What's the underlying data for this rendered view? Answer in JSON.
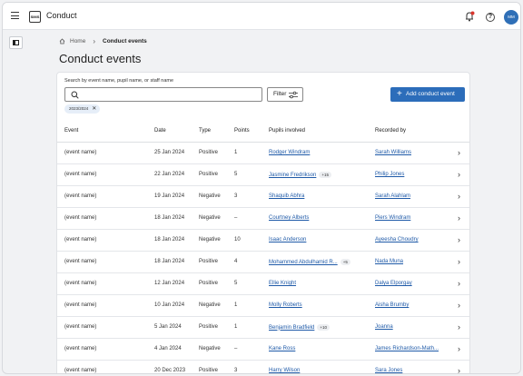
{
  "app": {
    "logo_text": "SIMS",
    "title": "Conduct",
    "avatar_initials": "MM"
  },
  "breadcrumb": {
    "home": "Home",
    "current": "Conduct events"
  },
  "page": {
    "title": "Conduct events"
  },
  "search": {
    "label": "Search by event name, pupil name, or staff name",
    "value": "",
    "placeholder": ""
  },
  "filter": {
    "label": "Filter"
  },
  "add_button": {
    "label": "Add conduct event"
  },
  "active_filter": {
    "label": "2023/2024"
  },
  "table": {
    "headers": [
      "Event",
      "Date",
      "Type",
      "Points",
      "Pupils involved",
      "Recorded by"
    ],
    "rows": [
      {
        "event": "(event name)",
        "date": "25 Jan 2024",
        "type": "Positive",
        "points": "1",
        "pupil": "Rodger Windram",
        "extra": "",
        "recorded": "Sarah Williams"
      },
      {
        "event": "(event name)",
        "date": "22 Jan 2024",
        "type": "Positive",
        "points": "5",
        "pupil": "Jasmine Fredrikson",
        "extra": "+15",
        "recorded": "Philip Jones"
      },
      {
        "event": "(event name)",
        "date": "19 Jan 2024",
        "type": "Negative",
        "points": "3",
        "pupil": "Shaquib Abhra",
        "extra": "",
        "recorded": "Sarah Alahlam"
      },
      {
        "event": "(event name)",
        "date": "18 Jan 2024",
        "type": "Negative",
        "points": "–",
        "pupil": "Courtney Alberts",
        "extra": "",
        "recorded": "Piers Windram"
      },
      {
        "event": "(event name)",
        "date": "18 Jan 2024",
        "type": "Negative",
        "points": "10",
        "pupil": "Isaac Anderson",
        "extra": "",
        "recorded": "Ayeesha Choudry"
      },
      {
        "event": "(event name)",
        "date": "18 Jan 2024",
        "type": "Positive",
        "points": "4",
        "pupil": "Mohammed Abdulhamid R...",
        "extra": "+5",
        "recorded": "Nada Muna"
      },
      {
        "event": "(event name)",
        "date": "12 Jan 2024",
        "type": "Positive",
        "points": "5",
        "pupil": "Ellie Knight",
        "extra": "",
        "recorded": "Dalya Elporgay"
      },
      {
        "event": "(event name)",
        "date": "10 Jan 2024",
        "type": "Negative",
        "points": "1",
        "pupil": "Molly Roberts",
        "extra": "",
        "recorded": "Aisha Brumby"
      },
      {
        "event": "(event name)",
        "date": "5 Jan 2024",
        "type": "Positive",
        "points": "1",
        "pupil": "Benjamin Bradfield",
        "extra": "+10",
        "recorded": "Joanna"
      },
      {
        "event": "(event name)",
        "date": "4 Jan 2024",
        "type": "Negative",
        "points": "–",
        "pupil": "Kane Ross",
        "extra": "",
        "recorded": "James Richardson-Math..."
      },
      {
        "event": "(event name)",
        "date": "20 Dec 2023",
        "type": "Positive",
        "points": "3",
        "pupil": "Harry Wilson",
        "extra": "",
        "recorded": "Sara Jones"
      }
    ]
  },
  "colors": {
    "accent": "#2c6dba",
    "link": "#1f5aa8",
    "notification": "#d9342b"
  },
  "icons": [
    "hamburger-icon",
    "bell-icon",
    "help-icon",
    "sidebar-toggle-icon",
    "home-icon",
    "chevron-right-icon",
    "search-icon",
    "filter-sliders-icon",
    "plus-icon",
    "close-icon"
  ]
}
